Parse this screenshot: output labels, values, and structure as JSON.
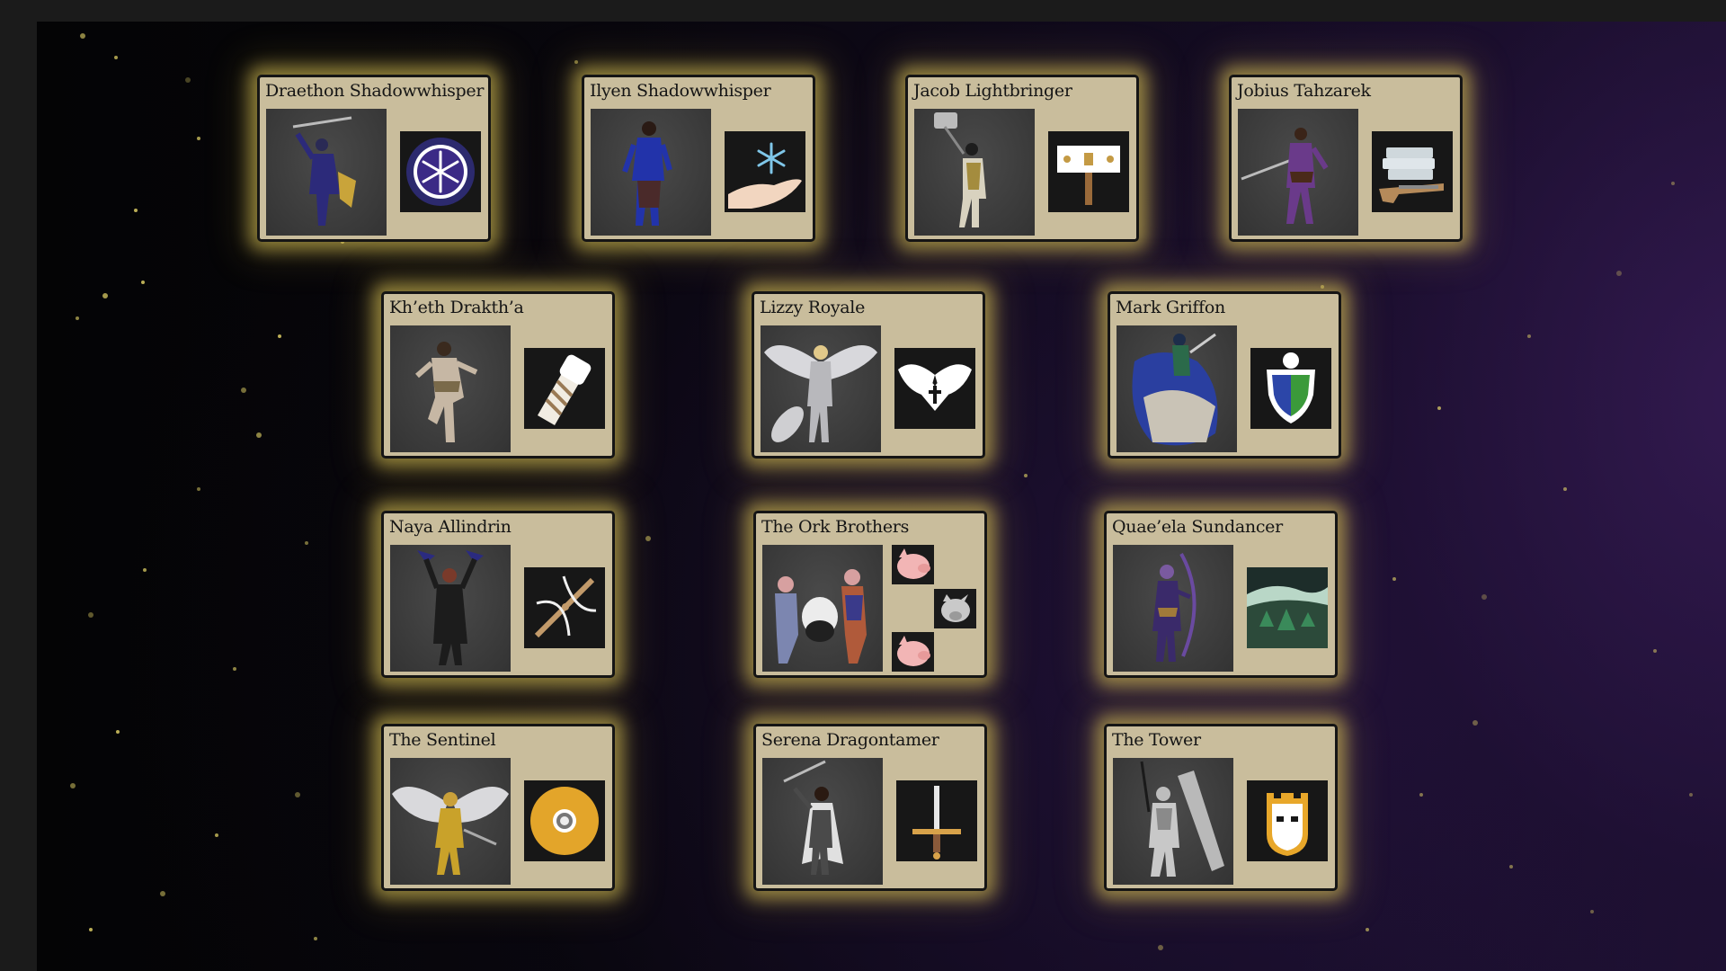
{
  "colors": {
    "card_bg": "#c9bd9c",
    "card_border": "#151515",
    "glow": "#e7d05b",
    "emblem_bg": "#171717",
    "background_dark": "#050406",
    "background_purple": "#22143a"
  },
  "characters": [
    {
      "name": "Draethon Shadowwhisper",
      "portrait": "armored-swordsman-figure",
      "emblem": "snowflake-circle-icon"
    },
    {
      "name": "Ilyen Shadowwhisper",
      "portrait": "blue-robed-figure",
      "emblem": "hand-snowflake-icon"
    },
    {
      "name": "Jacob Lightbringer",
      "portrait": "hammer-wielding-knight-figure",
      "emblem": "warhammer-icon"
    },
    {
      "name": "Jobius Tahzarek",
      "portrait": "rogue-sword-figure",
      "emblem": "books-and-musket-icon"
    },
    {
      "name": "Kh’eth Drakth’a",
      "portrait": "monk-figure",
      "emblem": "wrapped-fist-icon"
    },
    {
      "name": "Lizzy Royale",
      "portrait": "winged-paladin-figure",
      "emblem": "winged-heart-cross-icon"
    },
    {
      "name": "Mark Griffon",
      "portrait": "griffon-rider-figure",
      "emblem": "griffon-shield-icon"
    },
    {
      "name": "Naya Allindrin",
      "portrait": "crossbow-figure",
      "emblem": "crossbow-icon"
    },
    {
      "name": "The Ork Brothers",
      "portrait": "three-ork-brothers-figure",
      "emblems": [
        "pig-head-icon",
        "boar-head-icon",
        "pig-head-icon"
      ]
    },
    {
      "name": "Quae’ela Sundancer",
      "portrait": "archer-figure",
      "emblem": "forest-landscape-icon"
    },
    {
      "name": "The Sentinel",
      "portrait": "golden-winged-angel-figure",
      "emblem": "golden-shield-disc-icon"
    },
    {
      "name": "Serena Dragontamer",
      "portrait": "swordswoman-figure",
      "emblem": "upright-sword-icon"
    },
    {
      "name": "The Tower",
      "portrait": "knight-with-greatsword-figure",
      "emblem": "tower-helm-icon"
    }
  ]
}
